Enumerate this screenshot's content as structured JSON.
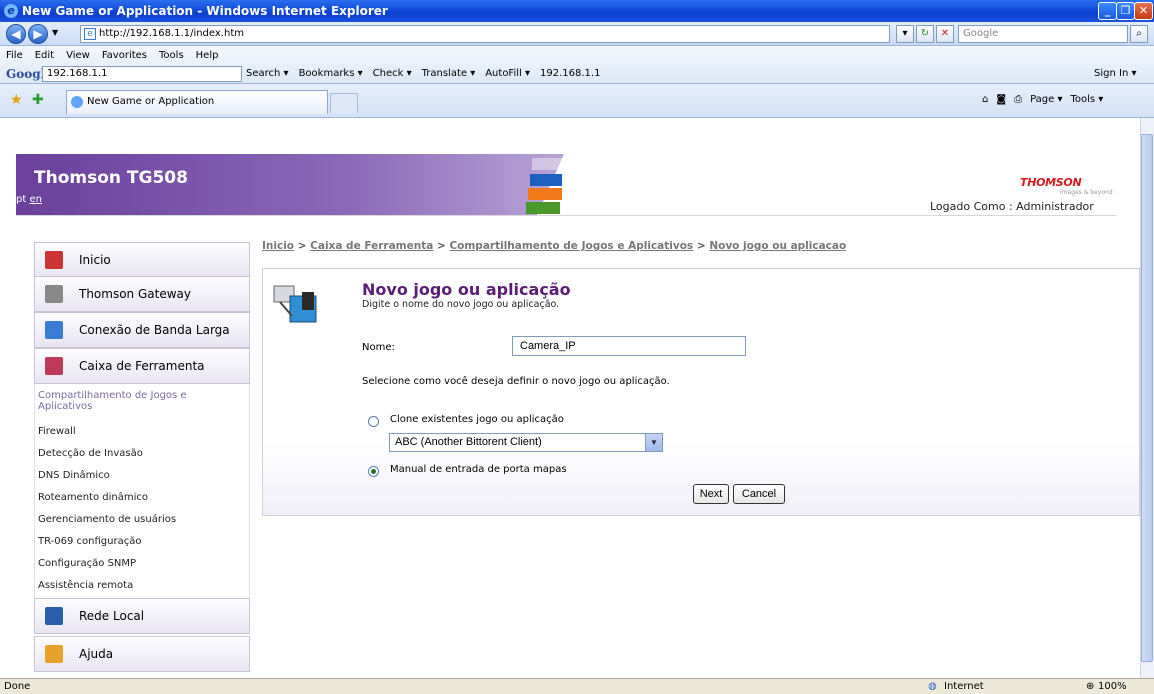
{
  "window": {
    "title": "New Game or Application - Windows Internet Explorer"
  },
  "address_bar": {
    "url": "http://192.168.1.1/index.htm",
    "search_placeholder": "Google"
  },
  "menu": {
    "items": [
      "File",
      "Edit",
      "View",
      "Favorites",
      "Tools",
      "Help"
    ]
  },
  "google_toolbar": {
    "label": "Google",
    "query": "192.168.1.1",
    "buttons": [
      "Search ▾",
      "Bookmarks ▾",
      "Check ▾",
      "Translate ▾",
      "AutoFill ▾",
      "192.168.1.1"
    ],
    "sign_in": "Sign In ▾"
  },
  "tabs": [
    {
      "label": "New Game or Application"
    }
  ],
  "command_bar": {
    "page": "Page ▾",
    "tools": "Tools ▾"
  },
  "header": {
    "brand": "Thomson TG508",
    "lang_pt": "pt",
    "lang_en": "en",
    "logo": "THOMSON",
    "logo_tagline": "images & beyond",
    "logged_in": "Logado Como : Administrador"
  },
  "sidebar": {
    "items": [
      {
        "label": "Inicio",
        "icon": "home-icon"
      },
      {
        "label": "Thomson Gateway",
        "icon": "gateway-icon"
      },
      {
        "label": "Conexão de Banda Larga",
        "icon": "broadband-icon"
      },
      {
        "label": "Caixa de Ferramenta",
        "icon": "toolbox-icon"
      },
      {
        "label": "Rede Local",
        "icon": "network-icon"
      },
      {
        "label": "Ajuda",
        "icon": "help-icon"
      }
    ],
    "subitems": [
      "Compartilhamento de Jogos e Aplicativos",
      "Firewall",
      "Detecção de Invasão",
      "DNS Dinâmico",
      "Roteamento dinâmico",
      "Gerenciamento de usuários",
      "TR-069 configuração",
      "Configuração SNMP",
      "Assistência remota"
    ]
  },
  "breadcrumb": {
    "inicio": "Inicio",
    "sep": ">",
    "toolbox": "Caixa de Ferramenta",
    "sharing": "Compartilhamento de Jogos e Aplicativos",
    "current": "Novo jogo ou aplicacao"
  },
  "form": {
    "title": "Novo jogo ou aplicação",
    "subtitle": "Digite o nome do novo jogo ou aplicação.",
    "name_label": "Nome:",
    "name_value": "Camera_IP",
    "define_question": "Selecione como você deseja definir o novo jogo ou aplicação.",
    "clone_label": "Clone existentes jogo ou aplicação",
    "clone_selected": "ABC (Another Bittorent Client)",
    "manual_label": "Manual de entrada de porta mapas",
    "selected_option": "manual",
    "next_label": "Next",
    "cancel_label": "Cancel"
  },
  "status_bar": {
    "left": "Done",
    "zone": "Internet",
    "zoom": "100%"
  },
  "colors": {
    "brand_purple": "#6b3f9b",
    "title_purple": "#5a1f74",
    "thomson_red": "#d41c1c"
  }
}
